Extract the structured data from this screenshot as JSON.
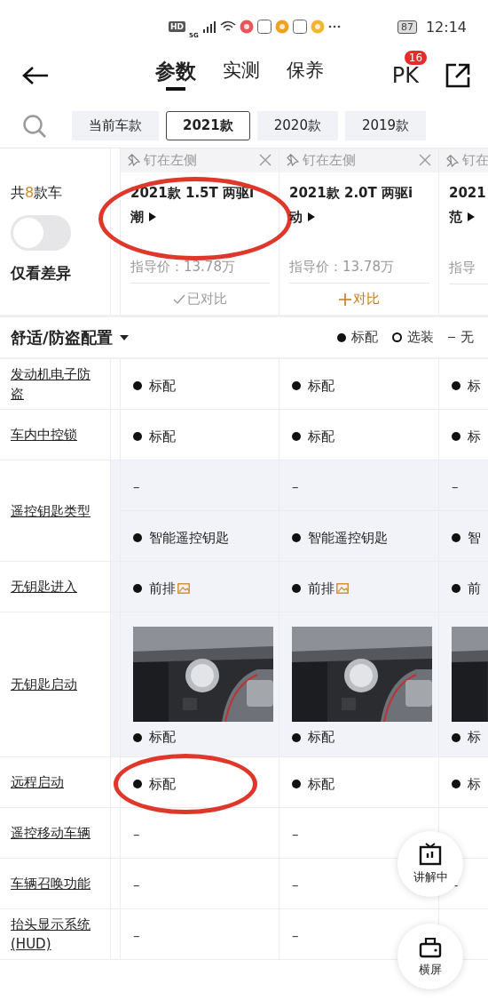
{
  "status_bar": {
    "hd": "HD",
    "network": "5G",
    "battery": "87",
    "time": "12:14"
  },
  "nav": {
    "tabs": [
      {
        "label": "参数",
        "selected": true
      },
      {
        "label": "实测",
        "selected": false
      },
      {
        "label": "保养",
        "selected": false
      }
    ],
    "pk": {
      "label": "PK",
      "badge": "16"
    }
  },
  "years": [
    {
      "label": "当前车款",
      "selected": false
    },
    {
      "label": "2021款",
      "selected": true
    },
    {
      "label": "2020款",
      "selected": false
    },
    {
      "label": "2019款",
      "selected": false
    }
  ],
  "summary": {
    "prefix": "共",
    "count": "8",
    "suffix": "款车",
    "toggle": {
      "label": "仅看差异",
      "on": false
    }
  },
  "cars": [
    {
      "pin": "钉在左侧",
      "closable": true,
      "title": "2021款 1.5T 两驱i\n潮",
      "price": "指导价：13.78万",
      "compared": true,
      "compare_label": "已对比",
      "circled": true
    },
    {
      "pin": "钉在左侧",
      "closable": true,
      "title": "2021款 2.0T 两驱i\n动",
      "price": "指导价：13.78万",
      "compared": false,
      "compare_label": "对比",
      "circled": false
    },
    {
      "pin": "钉在",
      "closable": false,
      "title": "2021\n范",
      "price": "指导",
      "circled": false
    }
  ],
  "section": {
    "title": "舒适/防盗配置",
    "legend": [
      {
        "kind": "standard",
        "label": "标配"
      },
      {
        "kind": "optional",
        "label": "选装"
      },
      {
        "kind": "none",
        "label": "无"
      }
    ]
  },
  "rows": [
    {
      "label": "发动机电子防盗",
      "shaded": false,
      "lines": [
        [
          {
            "kind": "standard",
            "text": "标配"
          },
          {
            "kind": "standard",
            "text": "标配"
          },
          {
            "kind": "standard",
            "text": "标"
          }
        ]
      ]
    },
    {
      "label": "车内中控锁",
      "shaded": false,
      "lines": [
        [
          {
            "kind": "standard",
            "text": "标配"
          },
          {
            "kind": "standard",
            "text": "标配"
          },
          {
            "kind": "standard",
            "text": "标"
          }
        ]
      ]
    },
    {
      "label": "遥控钥匙类型",
      "shaded": true,
      "lines": [
        [
          {
            "kind": "none",
            "text": "–"
          },
          {
            "kind": "none",
            "text": "–"
          },
          {
            "kind": "none",
            "text": "–"
          }
        ],
        [
          {
            "kind": "standard",
            "text": "智能遥控钥匙"
          },
          {
            "kind": "standard",
            "text": "智能遥控钥匙"
          },
          {
            "kind": "standard",
            "text": "智"
          }
        ]
      ]
    },
    {
      "label": "无钥匙进入",
      "shaded": true,
      "lines": [
        [
          {
            "kind": "standard",
            "text": "前排",
            "image_link": true
          },
          {
            "kind": "standard",
            "text": "前排",
            "image_link": true
          },
          {
            "kind": "standard",
            "text": "前"
          }
        ]
      ]
    },
    {
      "label": "无钥匙启动",
      "shaded": true,
      "lines": [
        [
          {
            "kind": "standard",
            "text": "标配",
            "picture": true
          },
          {
            "kind": "standard",
            "text": "标配",
            "picture": true
          },
          {
            "kind": "standard",
            "text": "标",
            "picture": true
          }
        ]
      ]
    },
    {
      "label": "远程启动",
      "shaded": false,
      "lines": [
        [
          {
            "kind": "standard",
            "text": "标配",
            "circled": true
          },
          {
            "kind": "standard",
            "text": "标配"
          },
          {
            "kind": "standard",
            "text": "标"
          }
        ]
      ]
    },
    {
      "label": "遥控移动车辆",
      "shaded": false,
      "lines": [
        [
          {
            "kind": "none",
            "text": "–"
          },
          {
            "kind": "none",
            "text": "–"
          }
        ]
      ]
    },
    {
      "label": "车辆召唤功能",
      "shaded": false,
      "lines": [
        [
          {
            "kind": "none",
            "text": "–"
          },
          {
            "kind": "none",
            "text": "–"
          },
          {
            "kind": "none",
            "text": "–"
          }
        ]
      ]
    },
    {
      "label": "抬头显示系统(HUD)",
      "shaded": false,
      "lines": [
        [
          {
            "kind": "none",
            "text": "–"
          },
          {
            "kind": "none",
            "text": "–"
          }
        ]
      ]
    }
  ],
  "floating": [
    {
      "kind": "tv",
      "label": "讲解中"
    },
    {
      "kind": "rotate",
      "label": "横屏"
    }
  ]
}
